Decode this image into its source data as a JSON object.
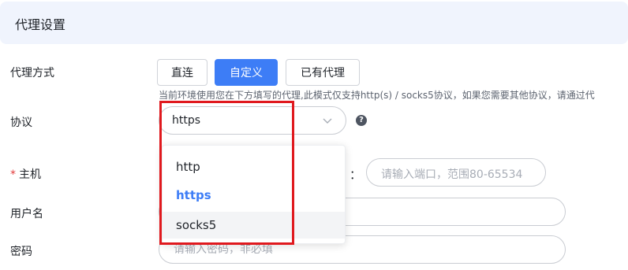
{
  "header": {
    "title": "代理设置"
  },
  "proxy_mode": {
    "label": "代理方式",
    "options": [
      {
        "label": "直连"
      },
      {
        "label": "自定义"
      },
      {
        "label": "已有代理"
      }
    ],
    "selected": "自定义",
    "hint": "当前环境使用您在下方填写的代理,此模式仅支持http(s) / socks5协议，如果您需要其他协议，请通过代"
  },
  "protocol": {
    "label": "协议",
    "value": "https",
    "options": [
      "http",
      "https",
      "socks5"
    ],
    "highlighted": "socks5"
  },
  "host": {
    "label": "主机",
    "port_separator": "：",
    "port_placeholder": "请输入端口，范围80-65534"
  },
  "username": {
    "label": "用户名"
  },
  "password": {
    "label": "密码",
    "placeholder": "请输入密码，非必填"
  },
  "colors": {
    "accent": "#3d7df6",
    "header_bg": "#f0f4fd",
    "required": "#e23c3c",
    "annotation": "#e0191e"
  }
}
